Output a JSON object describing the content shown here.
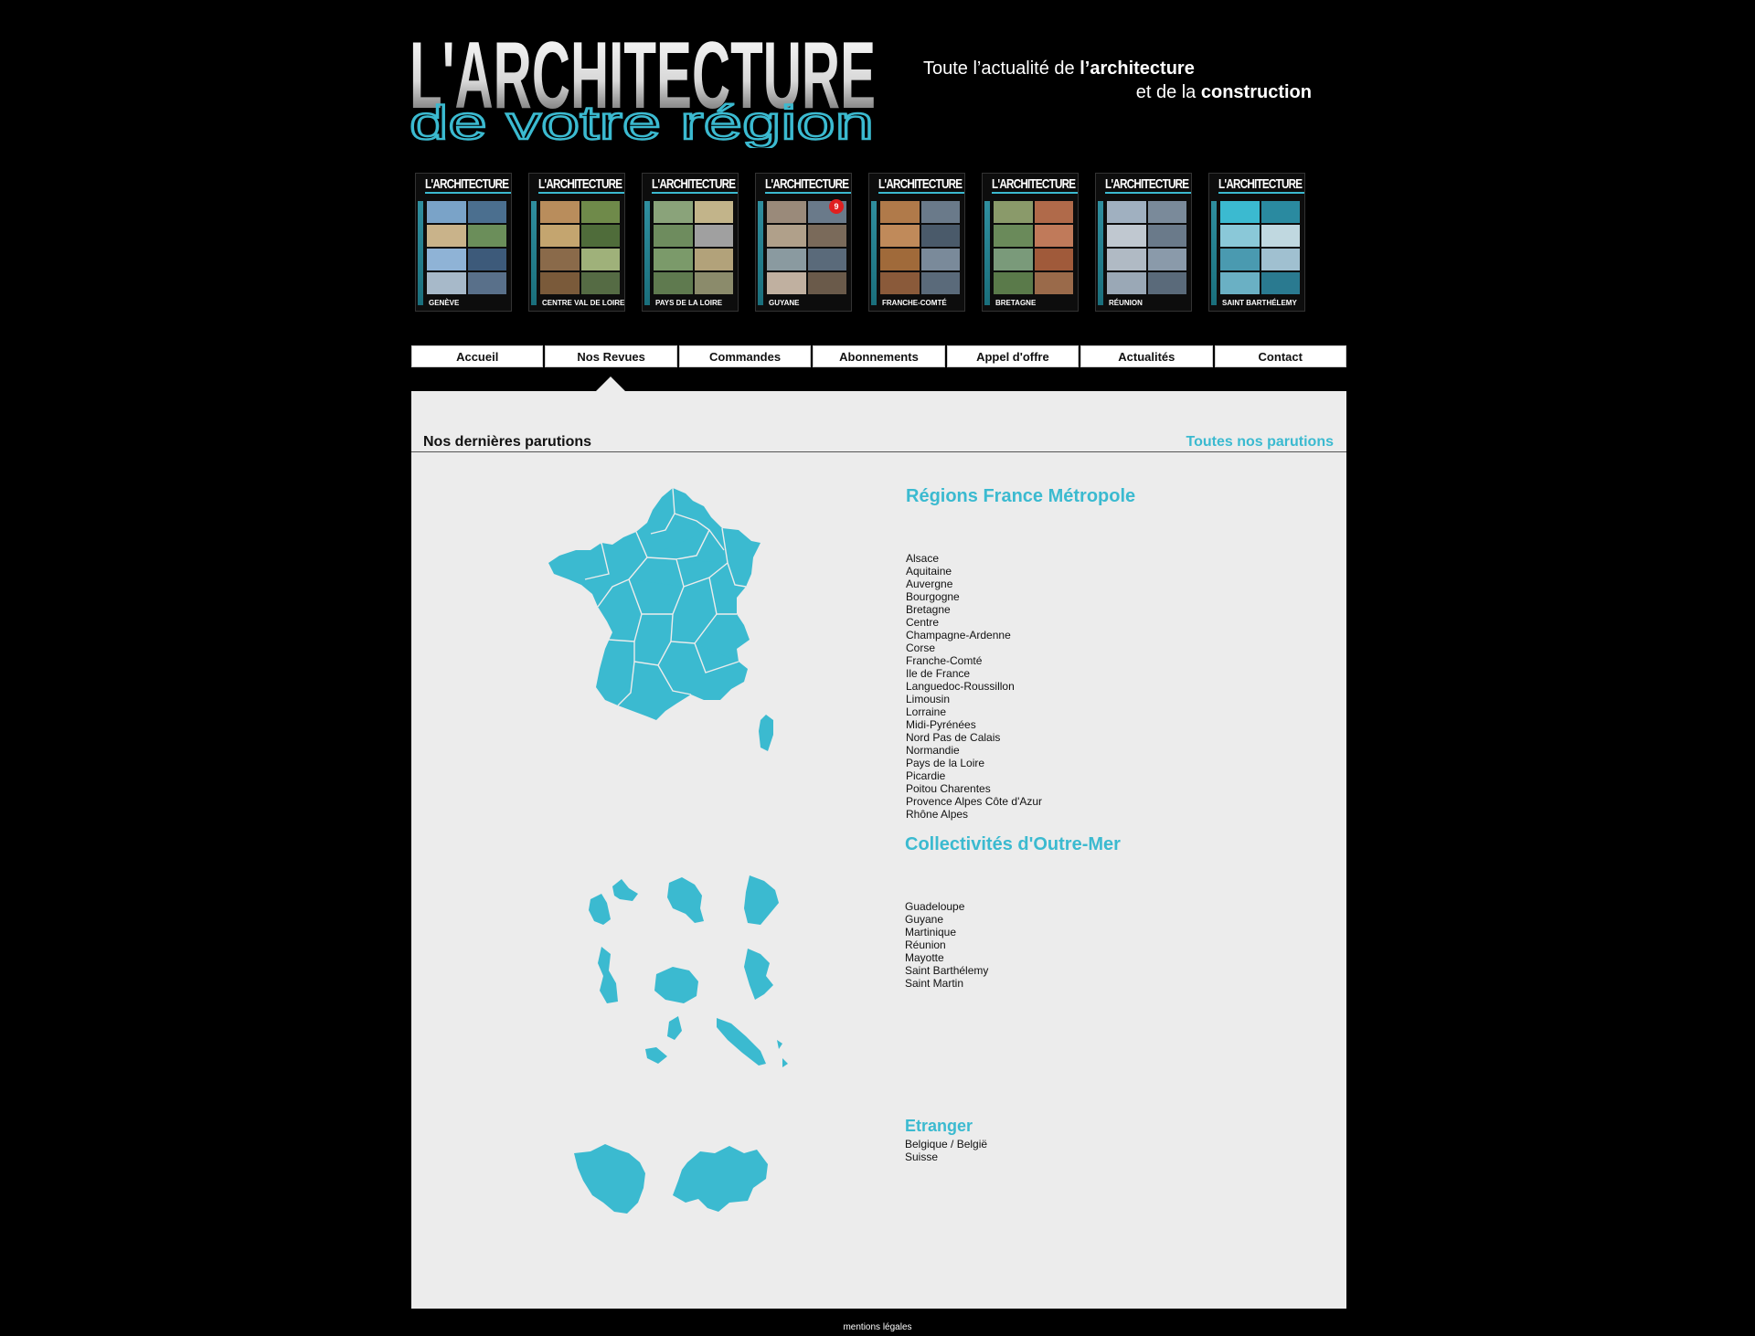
{
  "header": {
    "logo_line1": "L'ARCHITECTURE",
    "logo_line2": "de votre région",
    "tagline_1a": "Toute l’actualité de ",
    "tagline_1b": "l’architecture",
    "tagline_2a": "et de la ",
    "tagline_2b": "construction"
  },
  "covers": [
    {
      "foot": "GENÈVE",
      "badge": ""
    },
    {
      "foot": "CENTRE VAL DE LOIRE",
      "badge": ""
    },
    {
      "foot": "PAYS DE LA LOIRE",
      "badge": ""
    },
    {
      "foot": "GUYANE",
      "badge": "9"
    },
    {
      "foot": "FRANCHE-COMTÉ",
      "badge": ""
    },
    {
      "foot": "BRETAGNE",
      "badge": ""
    },
    {
      "foot": "RÉUNION",
      "badge": ""
    },
    {
      "foot": "SAINT BARTHÉLEMY",
      "badge": ""
    }
  ],
  "cover_masthead": "L'ARCHITECTURE",
  "nav": [
    "Accueil",
    "Nos Revues",
    "Commandes",
    "Abonnements",
    "Appel d'offre",
    "Actualités",
    "Contact"
  ],
  "active_nav": "Nos Revues",
  "section": {
    "title": "Nos dernières parutions",
    "all_link": "Toutes nos parutions"
  },
  "groups": {
    "metropole": {
      "title": "Régions France Métropole",
      "items": [
        "Alsace",
        "Aquitaine",
        "Auvergne",
        "Bourgogne",
        "Bretagne",
        "Centre",
        "Champagne-Ardenne",
        "Corse",
        "Franche-Comté",
        "Ile de France",
        "Languedoc-Roussillon",
        "Limousin",
        "Lorraine",
        "Midi-Pyrénées",
        "Nord Pas de Calais",
        "Normandie",
        "Pays de la Loire",
        "Picardie",
        "Poitou Charentes",
        "Provence Alpes Côte d'Azur",
        "Rhône Alpes"
      ]
    },
    "outremer": {
      "title": "Collectivités d'Outre-Mer",
      "items": [
        "Guadeloupe",
        "Guyane",
        "Martinique",
        "Réunion",
        "Mayotte",
        "Saint Barthélemy",
        "Saint Martin"
      ]
    },
    "etranger": {
      "title": "Etranger",
      "items": [
        "Belgique / België",
        "Suisse"
      ]
    }
  },
  "footer": {
    "link": "mentions légales"
  },
  "colors": {
    "accent": "#3bbad0",
    "background": "#000000",
    "panel": "#ececec"
  }
}
